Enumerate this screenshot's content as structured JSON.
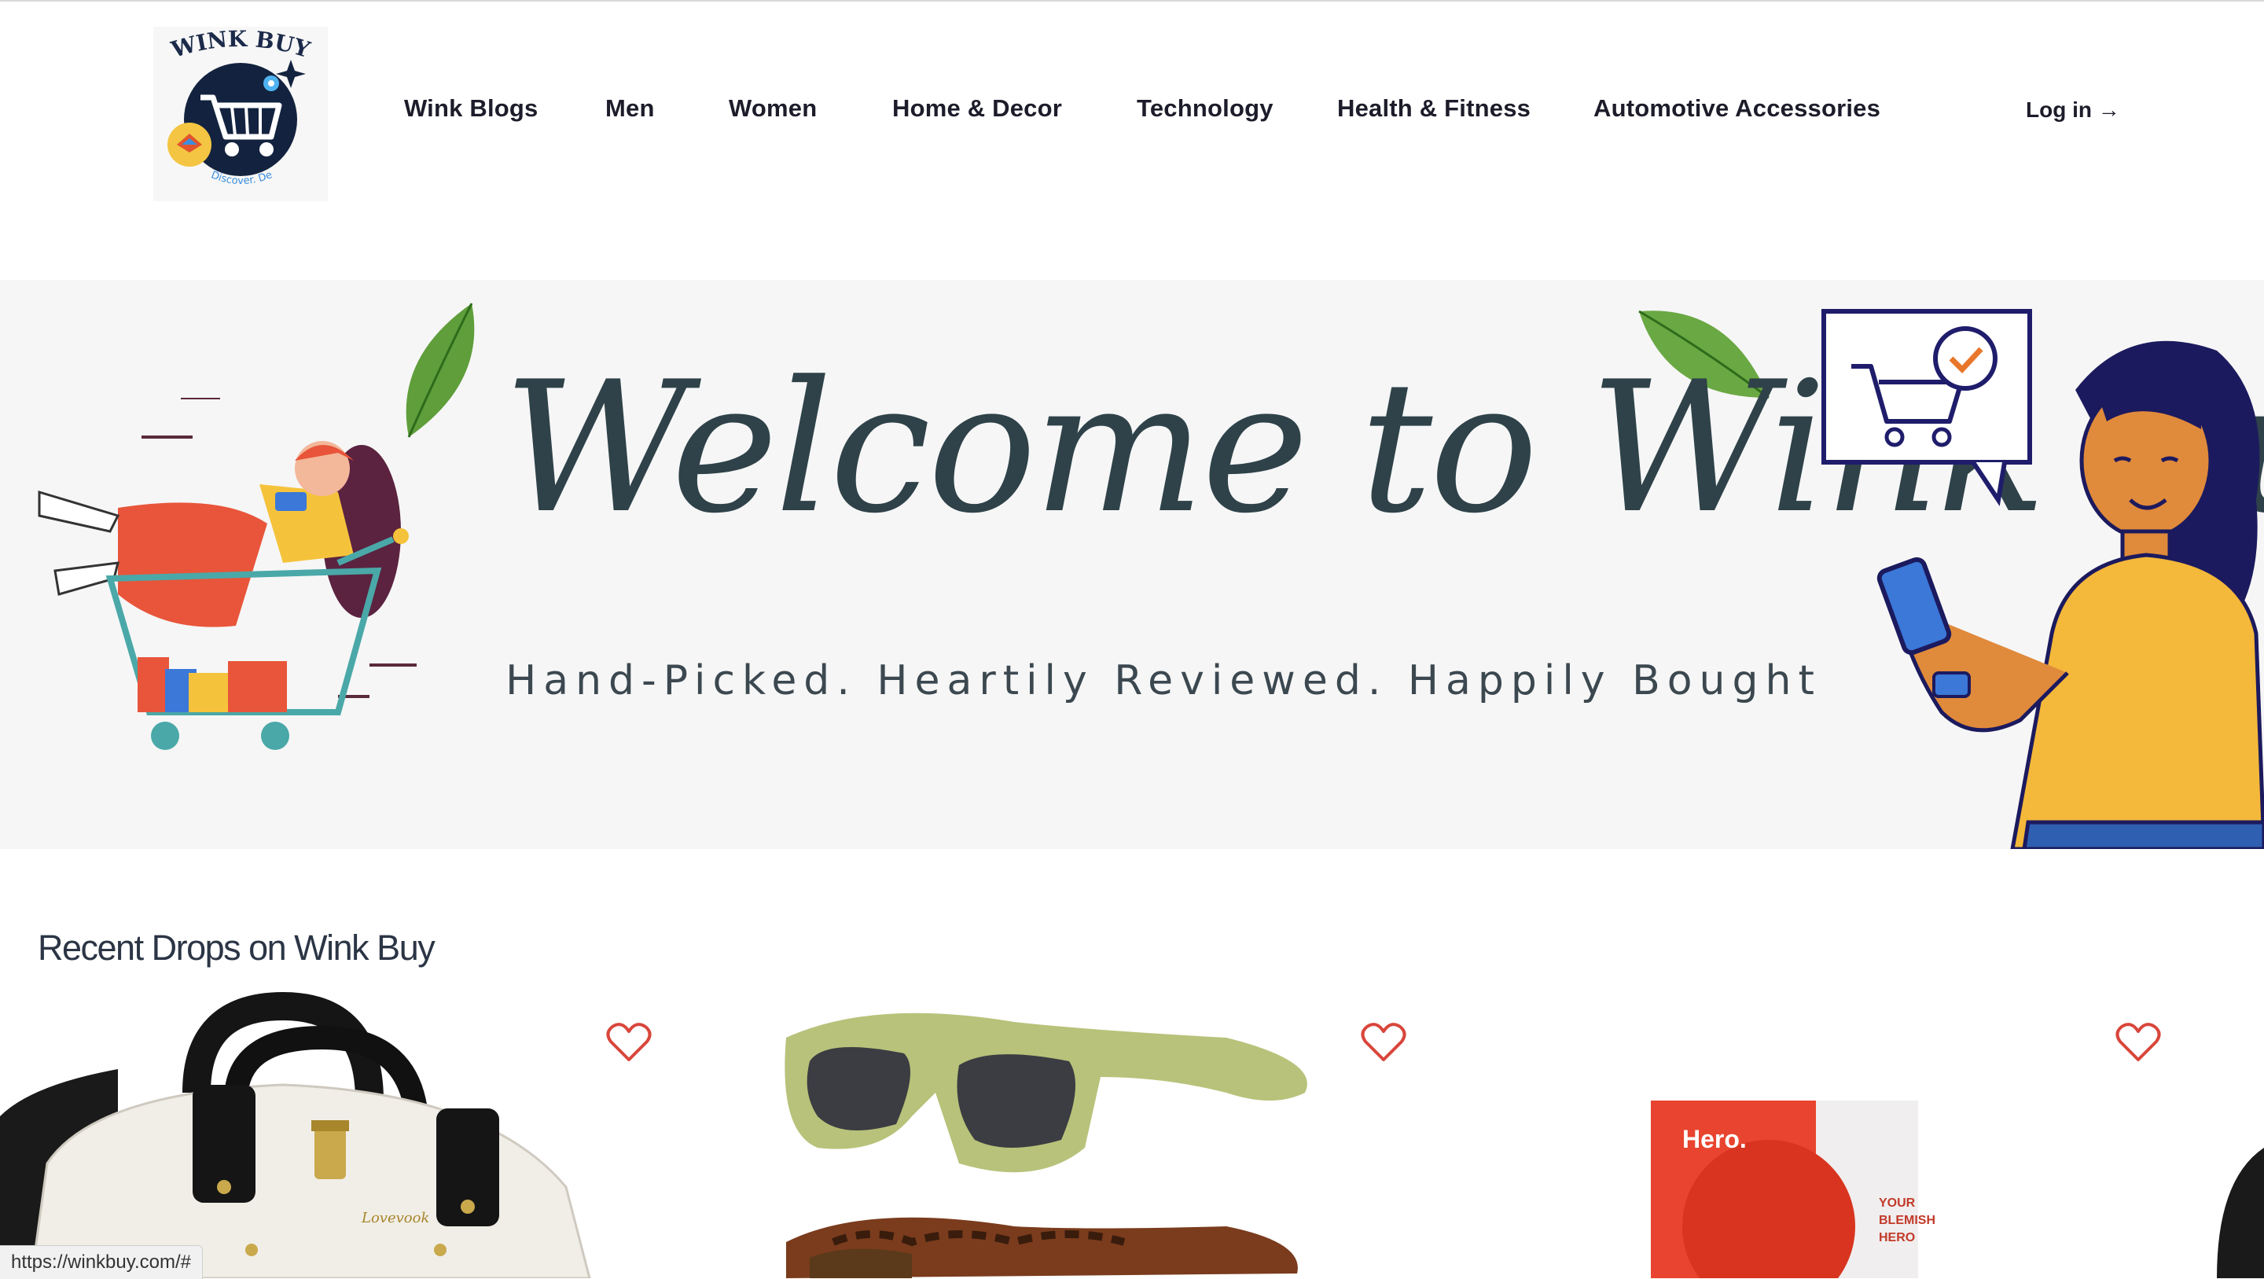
{
  "logo": {
    "text_top": "WINK BUY",
    "text_bottom": "Discover. De"
  },
  "nav": {
    "items": [
      {
        "label": "Wink Blogs"
      },
      {
        "label": "Men"
      },
      {
        "label": "Women"
      },
      {
        "label": "Home & Decor"
      },
      {
        "label": "Technology"
      },
      {
        "label": "Health & Fitness"
      },
      {
        "label": "Automotive Accessories"
      }
    ],
    "login_label": "Log in →"
  },
  "hero": {
    "title": "Welcome to Wink Buy",
    "subtitle": "Hand-Picked. Heartily Reviewed. Happily Bought"
  },
  "recent": {
    "title": "Recent Drops on Wink Buy",
    "products": [
      {
        "icon": "backpack-image",
        "brand_text": "Lovevook"
      },
      {
        "icon": "sunglasses-image"
      },
      {
        "icon": "hero-patch-image",
        "brand_text": "Hero.",
        "box_text": "YOUR BLEMISH HERO"
      }
    ]
  },
  "status_bar": {
    "url": "https://winkbuy.com/#"
  },
  "colors": {
    "heart": "#d9463b",
    "title_ink": "#2f4249",
    "nav_text": "#1c1c2a"
  }
}
